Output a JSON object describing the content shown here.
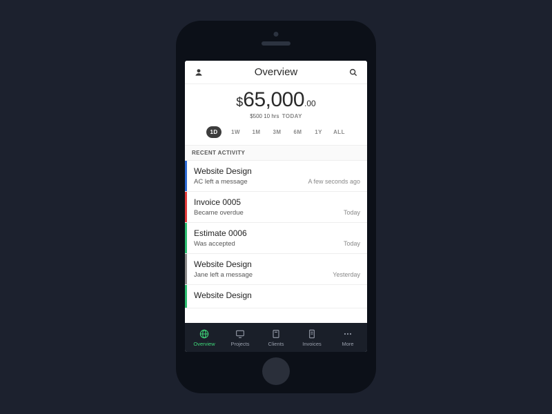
{
  "header": {
    "title": "Overview"
  },
  "summary": {
    "currency": "$",
    "amount_main": "65,000",
    "amount_cents": ".00",
    "sub_amount": "$500",
    "sub_hours": "10 hrs",
    "sub_label": "TODAY"
  },
  "ranges": [
    "1D",
    "1W",
    "1M",
    "3M",
    "6M",
    "1Y",
    "ALL"
  ],
  "range_active_index": 0,
  "section_label": "RECENT ACTIVITY",
  "colors": {
    "blue": "#2e6bd6",
    "red": "#e23b3b",
    "green": "#2fbf71",
    "gray": "#8a8a8a",
    "accent": "#3fd97a"
  },
  "activity": [
    {
      "title": "Website Design",
      "desc": "AC left a message",
      "time": "A few seconds ago",
      "stripe": "blue"
    },
    {
      "title": "Invoice 0005",
      "desc": "Became overdue",
      "time": "Today",
      "stripe": "red"
    },
    {
      "title": "Estimate 0006",
      "desc": "Was accepted",
      "time": "Today",
      "stripe": "green"
    },
    {
      "title": "Website Design",
      "desc": "Jane left a message",
      "time": "Yesterday",
      "stripe": "gray"
    },
    {
      "title": "Website Design",
      "desc": "",
      "time": "",
      "stripe": "green"
    }
  ],
  "tabs": [
    {
      "label": "Overview",
      "icon": "globe",
      "active": true
    },
    {
      "label": "Projects",
      "icon": "monitor",
      "active": false
    },
    {
      "label": "Clients",
      "icon": "users",
      "active": false
    },
    {
      "label": "Invoices",
      "icon": "file",
      "active": false
    },
    {
      "label": "More",
      "icon": "dots",
      "active": false
    }
  ]
}
